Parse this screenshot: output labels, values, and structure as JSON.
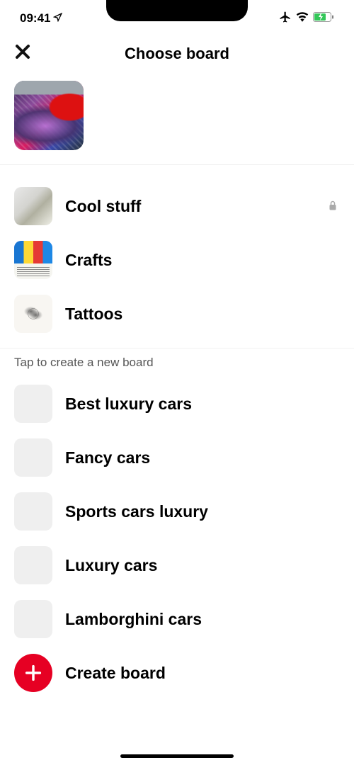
{
  "status": {
    "time": "09:41"
  },
  "header": {
    "title": "Choose board"
  },
  "boards": [
    {
      "label": "Cool stuff",
      "locked": true
    },
    {
      "label": "Crafts",
      "locked": false
    },
    {
      "label": "Tattoos",
      "locked": false
    }
  ],
  "suggest_hint": "Tap to create a new board",
  "suggestions": [
    {
      "label": "Best luxury cars"
    },
    {
      "label": "Fancy cars"
    },
    {
      "label": "Sports cars luxury"
    },
    {
      "label": "Luxury cars"
    },
    {
      "label": "Lamborghini cars"
    }
  ],
  "create_label": "Create board"
}
